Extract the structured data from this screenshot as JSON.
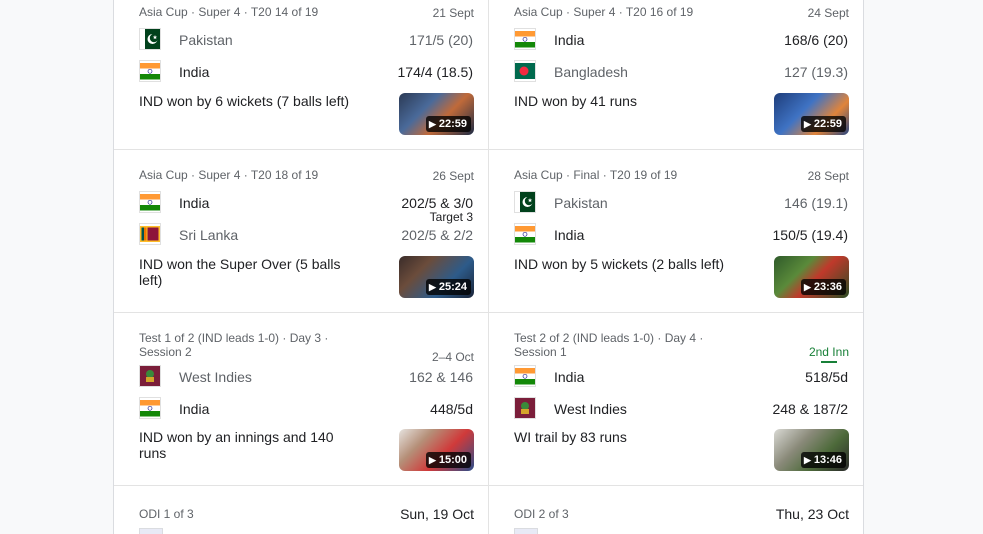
{
  "matches": [
    {
      "meta": "Asia Cup · Super 4 · T20 14 of 19",
      "date": "21 Sept",
      "team1": {
        "name": "Pakistan",
        "score": "171/5 (20)",
        "flag": "pakistan-flag"
      },
      "team2": {
        "name": "India",
        "score": "174/4 (18.5)",
        "flag": "india-flag"
      },
      "result": "IND won by 6 wickets (7 balls left)",
      "video_duration": "22:59"
    },
    {
      "meta": "Asia Cup · Super 4 · T20 16 of 19",
      "date": "24 Sept",
      "team1": {
        "name": "India",
        "score": "168/6 (20)",
        "flag": "india-flag"
      },
      "team2": {
        "name": "Bangladesh",
        "score": "127 (19.3)",
        "flag": "bangladesh-flag"
      },
      "result": "IND won by 41 runs",
      "video_duration": "22:59"
    },
    {
      "meta": "Asia Cup · Super 4 · T20 18 of 19",
      "date": "26 Sept",
      "team1": {
        "name": "India",
        "score": "202/5 & 3/0",
        "sub": "Target 3",
        "flag": "india-flag"
      },
      "team2": {
        "name": "Sri Lanka",
        "score": "202/5 & 2/2",
        "flag": "sri-lanka-flag"
      },
      "result": "IND won the Super Over (5 balls left)",
      "video_duration": "25:24"
    },
    {
      "meta": "Asia Cup · Final · T20 19 of 19",
      "date": "28 Sept",
      "team1": {
        "name": "Pakistan",
        "score": "146 (19.1)",
        "flag": "pakistan-flag"
      },
      "team2": {
        "name": "India",
        "score": "150/5 (19.4)",
        "flag": "india-flag"
      },
      "result": "IND won by 5 wickets (2 balls left)",
      "video_duration": "23:36"
    },
    {
      "meta": "Test 1 of 2 (IND leads 1-0) · Day 3 · Session 2",
      "date": "2–4 Oct",
      "team1": {
        "name": "West Indies",
        "score": "162 & 146",
        "flag": "west-indies-flag"
      },
      "team2": {
        "name": "India",
        "score": "448/5d",
        "flag": "india-flag"
      },
      "result": "IND won by an innings and 140 runs",
      "video_duration": "15:00"
    },
    {
      "meta": "Test 2 of 2 (IND leads 1-0) · Day 4 · Session 1",
      "status": "2nd Inn",
      "team1": {
        "name": "India",
        "score": "518/5d",
        "flag": "india-flag"
      },
      "team2": {
        "name": "West Indies",
        "score": "248 & 187/2",
        "flag": "west-indies-flag"
      },
      "result": "WI trail by 83 runs",
      "video_duration": "13:46"
    }
  ],
  "upcoming": [
    {
      "meta": "ODI 1 of 3",
      "date": "Sun, 19 Oct"
    },
    {
      "meta": "ODI 2 of 3",
      "date": "Thu, 23 Oct"
    }
  ],
  "colors": {
    "live_green": "#188038",
    "text": "#202124",
    "muted": "#5f6368",
    "divider": "#e3e3e3"
  }
}
